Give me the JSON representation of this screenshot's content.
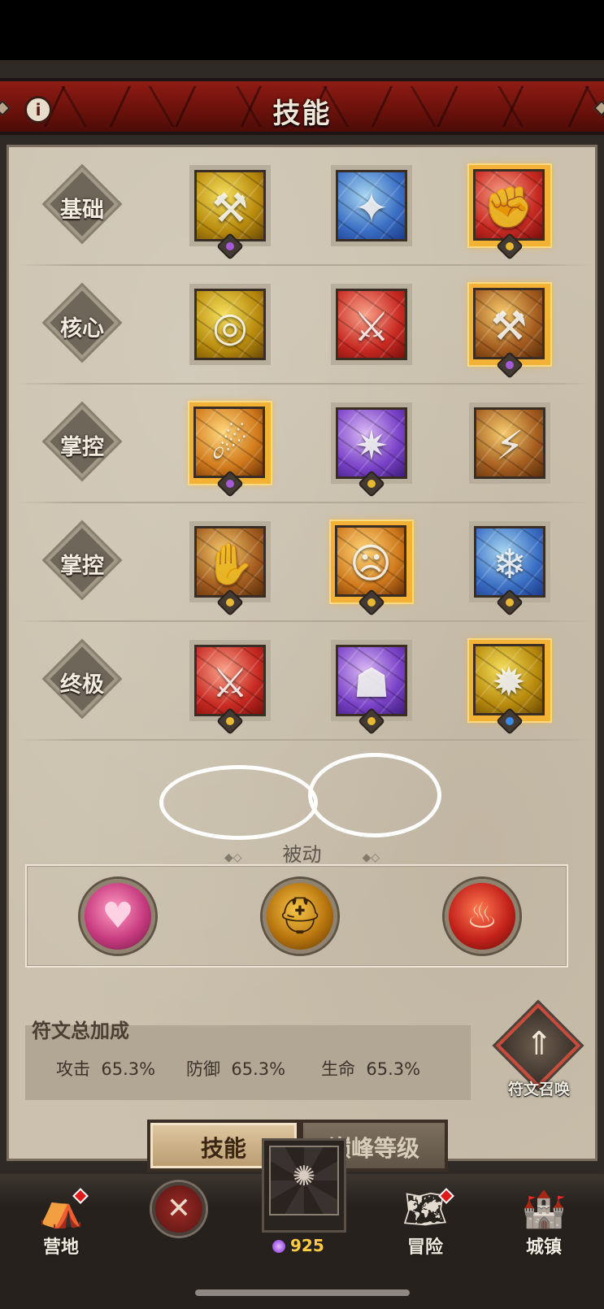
{
  "header": {
    "title": "技能",
    "info_icon": "info-icon"
  },
  "skill_rows": [
    {
      "label": "基础",
      "skills": [
        {
          "icon": "hammer-icon",
          "color": "gold",
          "glyph": "⚒",
          "selected": false,
          "rune": "purple-gem"
        },
        {
          "icon": "hammer-smash-icon",
          "color": "blue",
          "glyph": "✦",
          "selected": false,
          "rune": ""
        },
        {
          "icon": "punch-icon",
          "color": "red",
          "glyph": "✊",
          "selected": true,
          "rune": "yellow-gem"
        }
      ]
    },
    {
      "label": "核心",
      "skills": [
        {
          "icon": "whirlwind-icon",
          "color": "gold",
          "glyph": "◎",
          "selected": false,
          "rune": ""
        },
        {
          "icon": "blade-slash-icon",
          "color": "red",
          "glyph": "⚔",
          "selected": false,
          "rune": ""
        },
        {
          "icon": "hammer-slam-icon",
          "color": "brown",
          "glyph": "⚒",
          "selected": true,
          "rune": "purple-gem"
        }
      ]
    },
    {
      "label": "掌控",
      "skills": [
        {
          "icon": "charge-icon",
          "color": "orange",
          "glyph": "☄",
          "selected": true,
          "rune": "purple-gem"
        },
        {
          "icon": "shadow-burst-icon",
          "color": "purple",
          "glyph": "✷",
          "selected": false,
          "rune": "yellow-gem"
        },
        {
          "icon": "ground-slam-icon",
          "color": "brown",
          "glyph": "⚡",
          "selected": false,
          "rune": ""
        }
      ]
    },
    {
      "label": "掌控",
      "skills": [
        {
          "icon": "leap-icon",
          "color": "brown",
          "glyph": "✋",
          "selected": false,
          "rune": "yellow-gem"
        },
        {
          "icon": "war-cry-icon",
          "color": "orange",
          "glyph": "☹",
          "selected": true,
          "rune": "yellow-gem"
        },
        {
          "icon": "frost-shout-icon",
          "color": "blue",
          "glyph": "❄",
          "selected": false,
          "rune": "yellow-gem"
        }
      ]
    },
    {
      "label": "终极",
      "skills": [
        {
          "icon": "blood-blade-icon",
          "color": "red",
          "glyph": "⚔",
          "selected": false,
          "rune": "yellow-gem"
        },
        {
          "icon": "demon-helm-icon",
          "color": "purple",
          "glyph": "☗",
          "selected": false,
          "rune": "yellow-gem"
        },
        {
          "icon": "rage-icon",
          "color": "gold",
          "glyph": "✹",
          "selected": true,
          "rune": "blue-gem"
        }
      ]
    }
  ],
  "passive": {
    "title": "被动",
    "items": [
      {
        "icon": "heart-icon",
        "color": "pink",
        "glyph": "♥"
      },
      {
        "icon": "helmet-icon",
        "color": "gold",
        "glyph": "⛑"
      },
      {
        "icon": "fire-face-icon",
        "color": "red",
        "glyph": "♨"
      }
    ]
  },
  "rune_bonus": {
    "title": "符文总加成",
    "stats": [
      {
        "label": "攻击",
        "value": "65.3%"
      },
      {
        "label": "防御",
        "value": "65.3%"
      },
      {
        "label": "生命",
        "value": "65.3%"
      }
    ],
    "summon_label": "符文召唤"
  },
  "tabs": {
    "active": "技能",
    "inactive": "巅峰等级"
  },
  "bottom_nav": {
    "camp": "营地",
    "adventure": "冒险",
    "town": "城镇",
    "gem_count": "925"
  },
  "colors": {
    "accent_gold": "#f3b236",
    "banner_red": "#8e1c14",
    "panel_bg": "#cbc1ae"
  }
}
